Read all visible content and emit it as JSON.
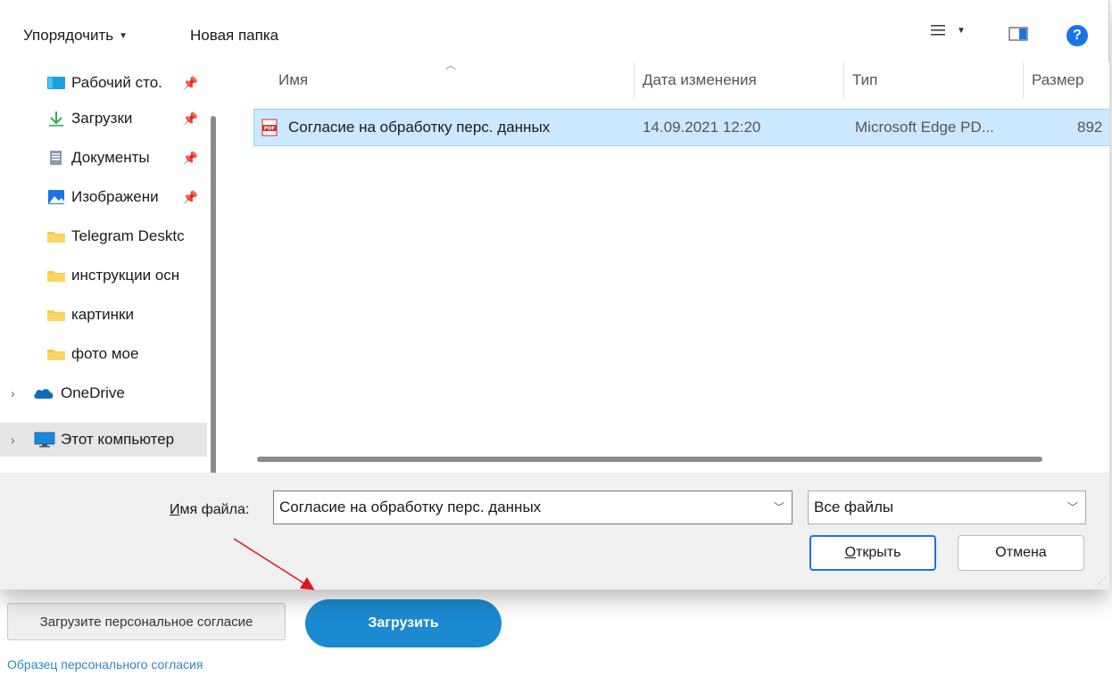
{
  "toolbar": {
    "organize": "Упорядочить",
    "new_folder": "Новая папка",
    "help": "?"
  },
  "nav": {
    "items": [
      {
        "label": "Рабочий сто.",
        "icon": "desktop-icon",
        "pinned": true
      },
      {
        "label": "Загрузки",
        "icon": "download-icon",
        "pinned": true
      },
      {
        "label": "Документы",
        "icon": "documents-icon",
        "pinned": true
      },
      {
        "label": "Изображени",
        "icon": "pictures-icon",
        "pinned": true
      },
      {
        "label": "Telegram Desktc",
        "icon": "folder-icon"
      },
      {
        "label": "инструкции осн",
        "icon": "folder-icon"
      },
      {
        "label": "картинки",
        "icon": "folder-icon"
      },
      {
        "label": "фото мое",
        "icon": "folder-icon"
      },
      {
        "label": "OneDrive",
        "icon": "onedrive-icon"
      },
      {
        "label": "Этот компьютер",
        "icon": "computer-icon"
      }
    ]
  },
  "columns": {
    "name": "Имя",
    "date": "Дата изменения",
    "type": "Тип",
    "size": "Размер"
  },
  "files": [
    {
      "name": "Согласие на обработку перс. данных",
      "date": "14.09.2021 12:20",
      "type": "Microsoft Edge PD...",
      "size": "892",
      "icon": "pdf-icon"
    }
  ],
  "bottom": {
    "filename_label_u": "И",
    "filename_label_rest": "мя файла:",
    "filename_value": "Согласие на обработку перс. данных",
    "filetype_value": "Все файлы",
    "open_label_u": "О",
    "open_label_rest": "ткрыть",
    "cancel_label": "Отмена"
  },
  "page": {
    "upload_personal_label": "Загрузите персональное согласие",
    "upload_label": "Загрузить",
    "sample_link": "Образец персонального согласия"
  },
  "annotation": {
    "arrow_color": "#e0141c"
  },
  "colors": {
    "accent": "#1a73e8",
    "selection": "#cce8ff",
    "upload_button": "#1c8ad0",
    "link": "#2f84c9"
  }
}
